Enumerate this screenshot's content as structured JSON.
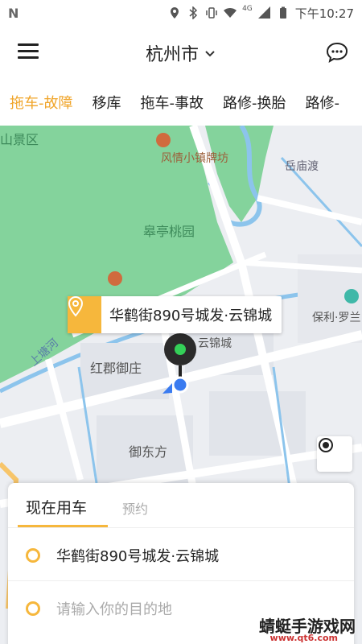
{
  "status_bar": {
    "network": "4G",
    "time": "下午10:27"
  },
  "header": {
    "city": "杭州市"
  },
  "service_tabs": [
    {
      "label": "拖车-故障",
      "active": true
    },
    {
      "label": "移库",
      "active": false
    },
    {
      "label": "拖车-事故",
      "active": false
    },
    {
      "label": "路修-换胎",
      "active": false
    },
    {
      "label": "路修-",
      "active": false
    }
  ],
  "map": {
    "labels": {
      "area1": "山景区",
      "shop": "风情小镇牌坊",
      "ferry": "岳庙渡",
      "park": "皋亭桃园",
      "river": "上塘河",
      "estate1": "红郡御庄",
      "estate2": "云锦城",
      "estate3": "御东方",
      "poly": "保利·罗兰"
    },
    "pickup_bubble": "华鹤街890号城发·云锦城"
  },
  "booking_card": {
    "tab_now": "现在用车",
    "tab_reserve": "预约",
    "origin": "华鹤街890号城发·云锦城",
    "destination_placeholder": "请输入你的目的地"
  },
  "watermark": {
    "text": "蜻蜓手游戏网",
    "url": "www.qt6.com"
  },
  "colors": {
    "accent": "#f6b73c",
    "active_tab": "#f0a52a",
    "park_green": "#7fcf95"
  }
}
